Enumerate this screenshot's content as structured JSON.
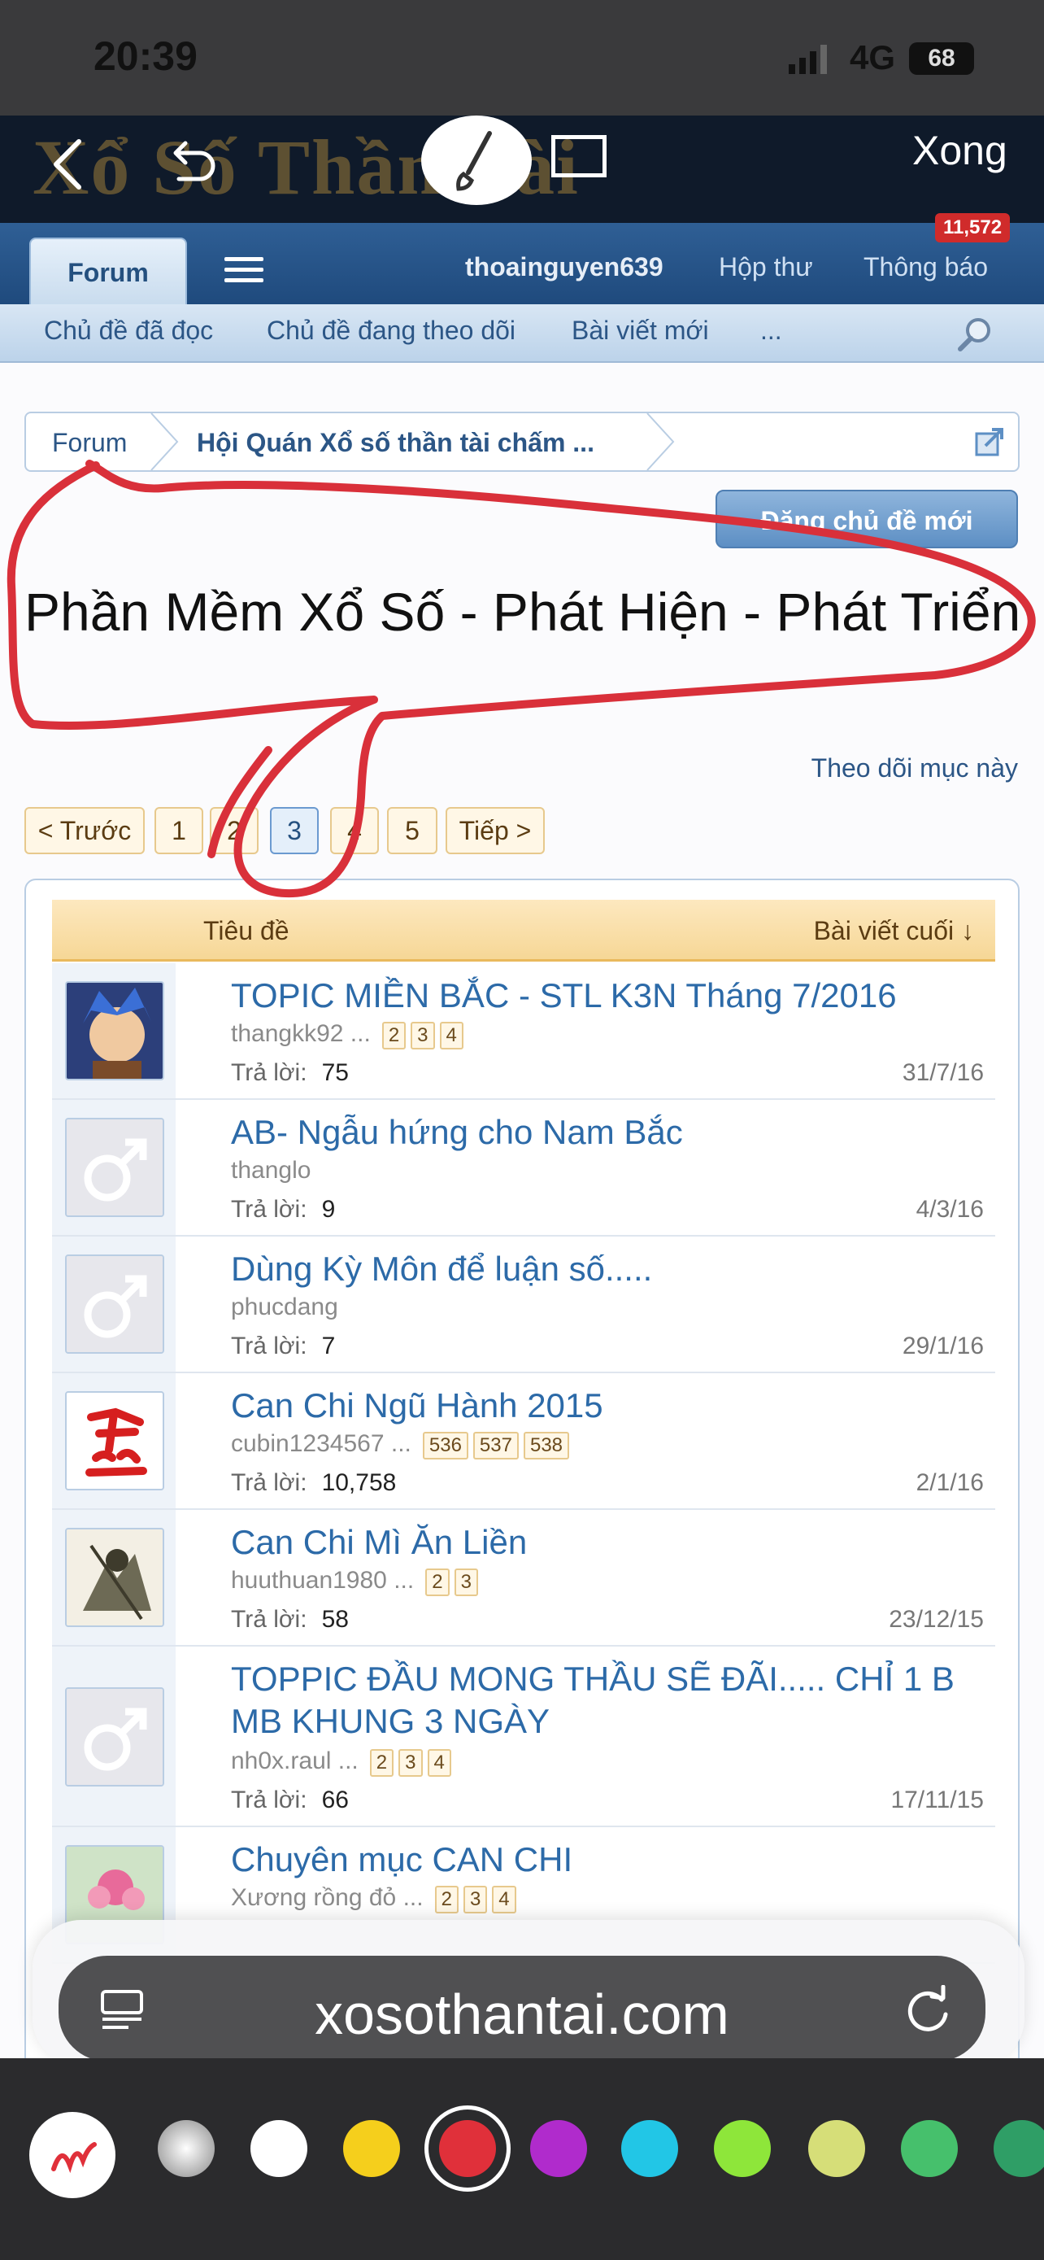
{
  "status": {
    "time": "20:39",
    "network": "4G",
    "battery": "68"
  },
  "markup": {
    "done_label": "Xong",
    "site_logo": "Xổ Số Thần Tài"
  },
  "nav": {
    "forum_tab": "Forum",
    "user": "thoainguyen639",
    "inbox": "Hộp thư",
    "alerts": "Thông báo",
    "alerts_badge": "11,572"
  },
  "subnav": {
    "items": [
      "Chủ đề đã đọc",
      "Chủ đề đang theo dõi",
      "Bài viết mới",
      "..."
    ]
  },
  "breadcrumb": {
    "root": "Forum",
    "current": "Hội Quán Xổ số thần tài chấm ..."
  },
  "new_thread_button": "Đăng chủ đề mới",
  "page_title": "Phần Mềm Xổ Số - Phát Hiện - Phát Triển",
  "follow_link": "Theo dõi mục này",
  "pagination": {
    "prev": "< Trước",
    "pages": [
      "1",
      "2",
      "3",
      "4",
      "5"
    ],
    "current": "3",
    "next": "Tiếp >"
  },
  "thread_list": {
    "col_title": "Tiêu đề",
    "col_last": "Bài viết cuối ↓",
    "replies_label": "Trả lời:",
    "threads": [
      {
        "title": "TOPIC MIỀN BẮC - STL K3N Tháng 7/2016",
        "author": "thangkk92",
        "ellipsis": "...",
        "pages": [
          "2",
          "3",
          "4"
        ],
        "replies": "75",
        "date": "31/7/16",
        "avatar": "anime-avatar"
      },
      {
        "title": "AB- Ngẫu hứng cho Nam Bắc",
        "author": "thanglo",
        "ellipsis": "",
        "pages": [],
        "replies": "9",
        "date": "4/3/16",
        "avatar": "male-placeholder-icon"
      },
      {
        "title": "Dùng Kỳ Môn để luận số.....",
        "author": "phucdang",
        "ellipsis": "",
        "pages": [],
        "replies": "7",
        "date": "29/1/16",
        "avatar": "male-placeholder-icon"
      },
      {
        "title": "Can Chi Ngũ Hành 2015",
        "author": "cubin1234567",
        "ellipsis": "...",
        "pages": [
          "536",
          "537",
          "538"
        ],
        "replies": "10,758",
        "date": "2/1/16",
        "avatar": "red-character-avatar"
      },
      {
        "title": "Can Chi Mì Ăn Liền",
        "author": "huuthuan1980",
        "ellipsis": "...",
        "pages": [
          "2",
          "3"
        ],
        "replies": "58",
        "date": "23/12/15",
        "avatar": "warrior-avatar"
      },
      {
        "title": "TOPPIC ĐẦU MONG THẦU SẼ ĐÃI..... CHỈ 1 B MB KHUNG 3 NGÀY",
        "author": "nh0x.raul",
        "ellipsis": "...",
        "pages": [
          "2",
          "3",
          "4"
        ],
        "replies": "66",
        "date": "17/11/15",
        "avatar": "male-placeholder-icon"
      },
      {
        "title": "Chuyên mục CAN CHI",
        "author": "Xương rồng đỏ",
        "ellipsis": "...",
        "pages": [
          "2",
          "3",
          "4"
        ],
        "replies": "",
        "date": "",
        "avatar": "flower-avatar"
      }
    ]
  },
  "browser": {
    "url": "xosothantai.com"
  },
  "palette": {
    "colors": [
      "#bdbdbd",
      "#ffffff",
      "#f5cf1c",
      "#e0303a",
      "#b02bcc",
      "#22c6e6",
      "#8ee63a",
      "#d6de78",
      "#46c06c",
      "#2f9e66"
    ],
    "selected": "#e0303a",
    "annotation_color": "#d9303a"
  }
}
